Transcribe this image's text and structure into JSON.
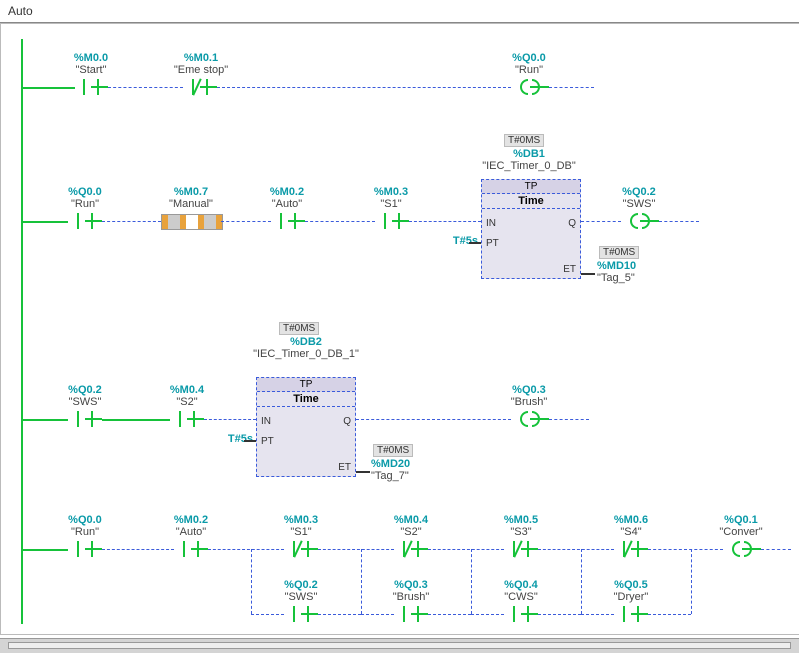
{
  "title": "Auto",
  "rung1": {
    "c1_addr": "%M0.0",
    "c1_name": "\"Start\"",
    "c2_addr": "%M0.1",
    "c2_name": "\"Eme stop\"",
    "out_addr": "%Q0.0",
    "out_name": "\"Run\""
  },
  "rung2": {
    "c1_addr": "%Q0.0",
    "c1_name": "\"Run\"",
    "c2_addr": "%M0.7",
    "c2_name": "\"Manual\"",
    "c3_addr": "%M0.2",
    "c3_name": "\"Auto\"",
    "c4_addr": "%M0.3",
    "c4_name": "\"S1\"",
    "timer_badge": "T#0MS",
    "timer_db": "%DB1",
    "timer_inst": "\"IEC_Timer_0_DB\"",
    "timer_tp": "TP",
    "timer_time": "Time",
    "timer_in": "IN",
    "timer_q": "Q",
    "timer_pt": "PT",
    "timer_et": "ET",
    "pt_val": "T#5s",
    "out_addr": "%Q0.2",
    "out_name": "\"SWS\"",
    "et_badge": "T#0MS",
    "et_addr": "%MD10",
    "et_name": "\"Tag_5\""
  },
  "rung3": {
    "c1_addr": "%Q0.2",
    "c1_name": "\"SWS\"",
    "c2_addr": "%M0.4",
    "c2_name": "\"S2\"",
    "timer_badge": "T#0MS",
    "timer_db": "%DB2",
    "timer_inst": "\"IEC_Timer_0_DB_1\"",
    "timer_tp": "TP",
    "timer_time": "Time",
    "timer_in": "IN",
    "timer_q": "Q",
    "timer_pt": "PT",
    "timer_et": "ET",
    "pt_val": "T#5s",
    "out_addr": "%Q0.3",
    "out_name": "\"Brush\"",
    "et_badge": "T#0MS",
    "et_addr": "%MD20",
    "et_name": "\"Tag_7\""
  },
  "rung4": {
    "c1_addr": "%Q0.0",
    "c1_name": "\"Run\"",
    "c2_addr": "%M0.2",
    "c2_name": "\"Auto\"",
    "nc1_addr": "%M0.3",
    "nc1_name": "\"S1\"",
    "nc2_addr": "%M0.4",
    "nc2_name": "\"S2\"",
    "nc3_addr": "%M0.5",
    "nc3_name": "\"S3\"",
    "nc4_addr": "%M0.6",
    "nc4_name": "\"S4\"",
    "out_addr": "%Q0.1",
    "out_name": "\"Conver\"",
    "br1_addr": "%Q0.2",
    "br1_name": "\"SWS\"",
    "br2_addr": "%Q0.3",
    "br2_name": "\"Brush\"",
    "br3_addr": "%Q0.4",
    "br3_name": "\"CWS\"",
    "br4_addr": "%Q0.5",
    "br4_name": "\"Dryer\""
  }
}
